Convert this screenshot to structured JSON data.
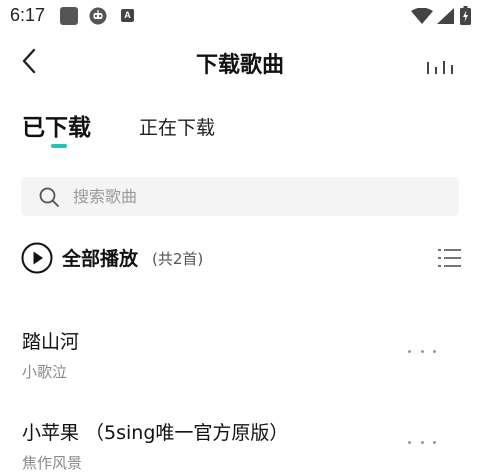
{
  "status_bar": {
    "time": "6:17",
    "notification_letter": "A"
  },
  "header": {
    "title": "下载歌曲"
  },
  "tabs": [
    {
      "label": "已下载",
      "active": true
    },
    {
      "label": "正在下载",
      "active": false
    }
  ],
  "search": {
    "placeholder": "搜索歌曲",
    "value": ""
  },
  "play_all": {
    "label": "全部播放",
    "count": "(共2首)"
  },
  "songs": [
    {
      "title": "踏山河",
      "artist": "小歌泣"
    },
    {
      "title": "小苹果 （5sing唯一官方原版）",
      "artist": "焦作风景"
    }
  ],
  "colors": {
    "accent": "#23c4b6",
    "text_primary": "#111111",
    "text_secondary": "#8a8a8a",
    "search_bg": "#f4f4f5"
  },
  "icons": {
    "back": "chevron-left-icon",
    "equalizer": "equalizer-bars-icon",
    "search": "search-icon",
    "play": "play-circle-icon",
    "list": "list-menu-icon",
    "more": "more-horizontal-icon"
  }
}
